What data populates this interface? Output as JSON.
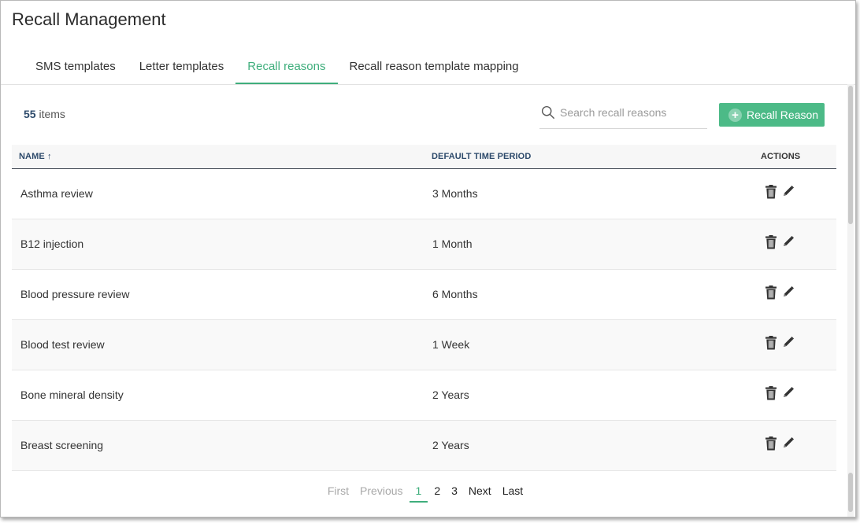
{
  "title": "Recall Management",
  "tabs": [
    {
      "label": "SMS templates"
    },
    {
      "label": "Letter templates"
    },
    {
      "label": "Recall reasons"
    },
    {
      "label": "Recall reason template mapping"
    }
  ],
  "active_tab": 2,
  "item_count": {
    "number": "55",
    "label": "items"
  },
  "search": {
    "placeholder": "Search recall reasons",
    "value": ""
  },
  "add_button": {
    "label": "Recall Reason"
  },
  "table": {
    "columns": {
      "name": "NAME",
      "sort_indicator": "↑",
      "period": "DEFAULT TIME PERIOD",
      "actions": "ACTIONS"
    },
    "rows": [
      {
        "name": "Asthma review",
        "period": "3 Months"
      },
      {
        "name": "B12 injection",
        "period": "1 Month"
      },
      {
        "name": "Blood pressure review",
        "period": "6 Months"
      },
      {
        "name": "Blood test review",
        "period": "1 Week"
      },
      {
        "name": "Bone mineral density",
        "period": "2 Years"
      },
      {
        "name": "Breast screening",
        "period": "2 Years"
      }
    ]
  },
  "pagination": {
    "first": "First",
    "previous": "Previous",
    "pages": [
      "1",
      "2",
      "3"
    ],
    "current": "1",
    "next": "Next",
    "last": "Last"
  },
  "icons": {
    "row_actions": [
      "trash-icon",
      "pencil-icon"
    ],
    "search": "magnifier-icon",
    "add": "plus-circle-icon"
  },
  "colors": {
    "accent": "#3fae7c",
    "button": "#4cba87",
    "header_text": "#2d4a6b"
  }
}
